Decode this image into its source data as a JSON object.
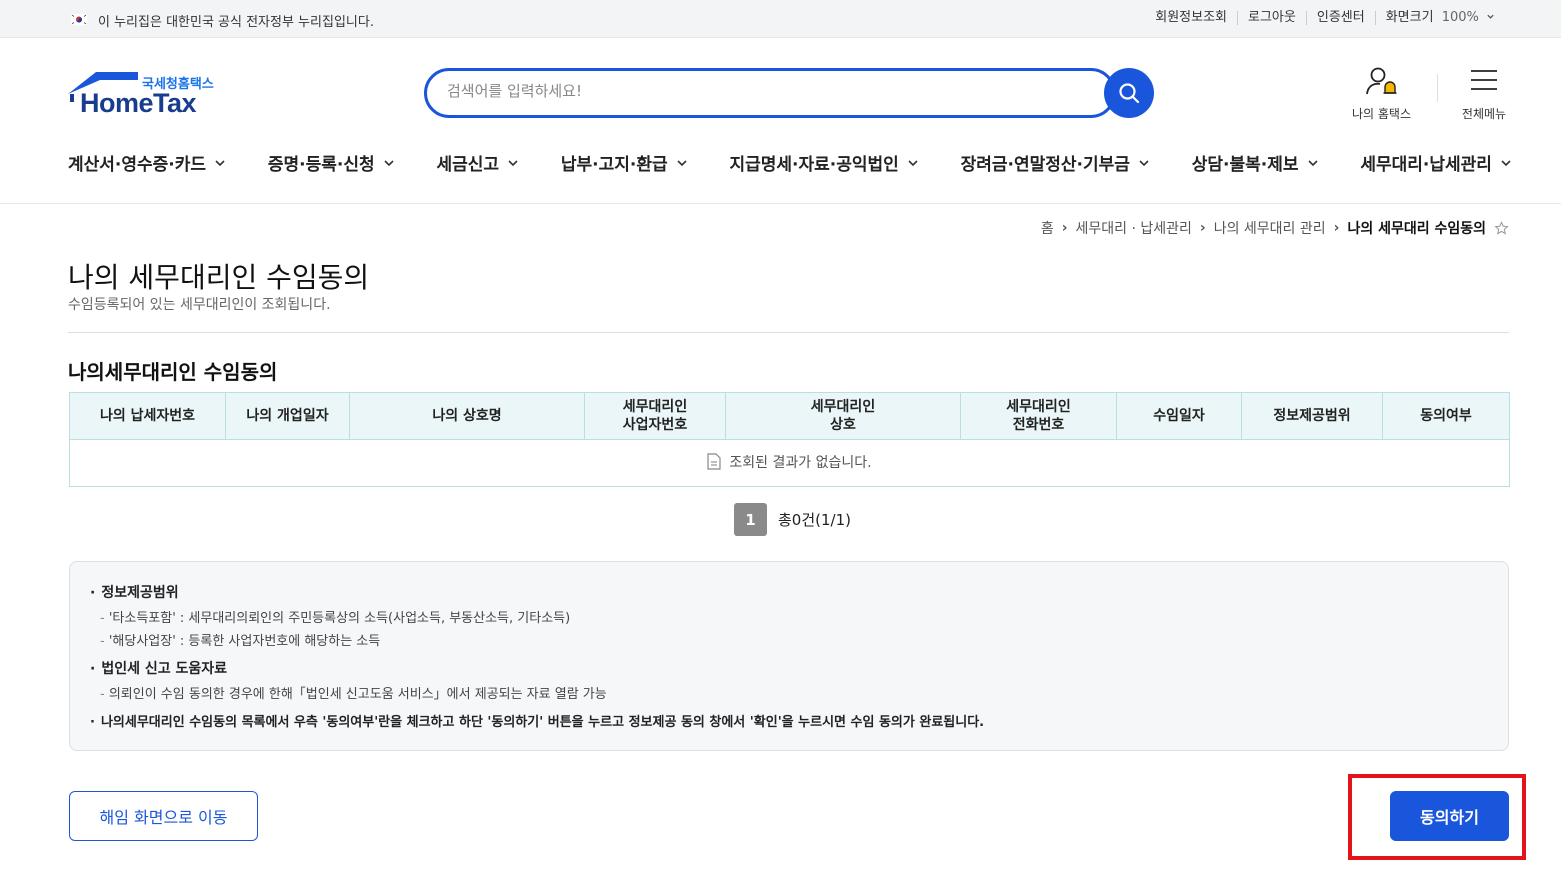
{
  "gov_bar": {
    "text": "이 누리집은 대한민국 공식 전자정부 누리집입니다.",
    "util_links": [
      "회원정보조회",
      "로그아웃",
      "인증센터"
    ],
    "zoom_label": "화면크기",
    "zoom_value": "100%"
  },
  "header": {
    "logo_sub": "국세청홈택스",
    "logo_main": "HomeTax",
    "search_placeholder": "검색어를 입력하세요!",
    "my_hometax": "나의 홈택스",
    "all_menu": "전체메뉴"
  },
  "gnb": [
    "계산서·영수증·카드",
    "증명·등록·신청",
    "세금신고",
    "납부·고지·환급",
    "지급명세·자료·공익법인",
    "장려금·연말정산·기부금",
    "상담·불복·제보",
    "세무대리·납세관리"
  ],
  "breadcrumb": {
    "home": "홈",
    "level1": "세무대리 · 납세관리",
    "level2": "나의 세무대리 관리",
    "current": "나의 세무대리 수임동의"
  },
  "page": {
    "title": "나의 세무대리인 수임동의",
    "description": "수임등록되어 있는 세무대리인이 조회됩니다.",
    "section_title": "나의세무대리인 수임동의"
  },
  "table": {
    "headers": [
      [
        "나의 납세자번호"
      ],
      [
        "나의 개업일자"
      ],
      [
        "나의 상호명"
      ],
      [
        "세무대리인",
        "사업자번호"
      ],
      [
        "세무대리인",
        "상호"
      ],
      [
        "세무대리인",
        "전화번호"
      ],
      [
        "수임일자"
      ],
      [
        "정보제공범위"
      ],
      [
        "동의여부"
      ]
    ],
    "empty_message": "조회된 결과가 없습니다."
  },
  "pagination": {
    "current_page": "1",
    "total": "총0건(1/1)"
  },
  "info": {
    "title1": "정보제공범위",
    "desc1a": "'타소득포함' : 세무대리의뢰인의 주민등록상의 소득(사업소득, 부동산소득, 기타소득)",
    "desc1b": "'해당사업장' : 등록한 사업자번호에 해당하는 소득",
    "title2": "법인세 신고 도움자료",
    "desc2a": "의뢰인이 수임 동의한 경우에 한해「법인세 신고도움 서비스」에서 제공되는 자료 열람 가능",
    "title3": "나의세무대리인 수임동의 목록에서 우측 '동의여부'란을 체크하고 하단 '동의하기' 버튼을 누르고 정보제공 동의 창에서 '확인'을 누르시면 수임 동의가 완료됩니다."
  },
  "buttons": {
    "dismiss": "해임 화면으로 이동",
    "agree": "동의하기"
  },
  "colors": {
    "primary": "#1a56db",
    "highlight": "#e3121b",
    "table_header_bg": "#eaf6f7"
  }
}
